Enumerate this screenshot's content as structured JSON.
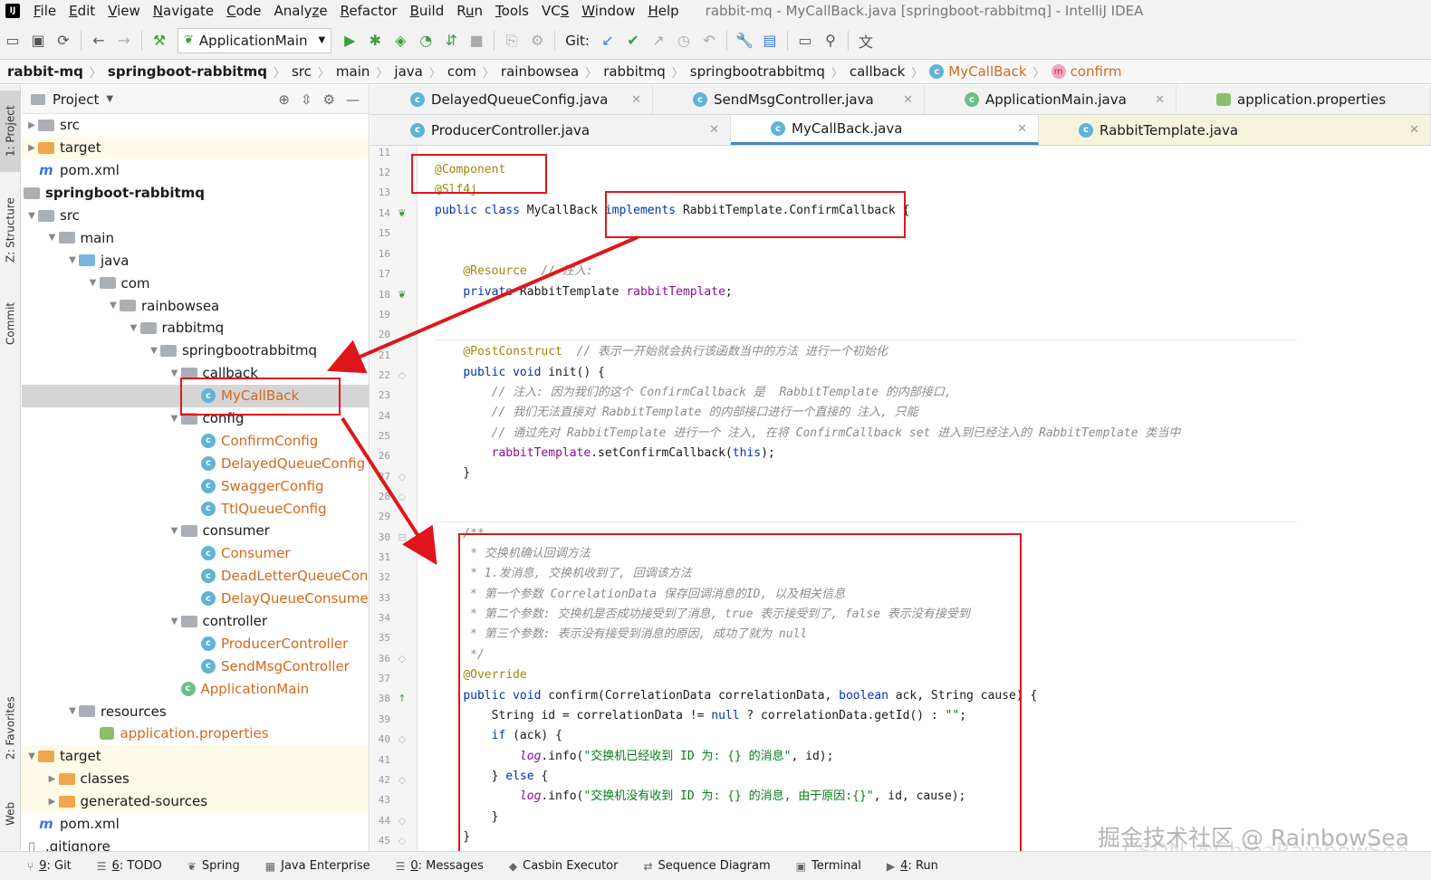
{
  "menu": {
    "items": [
      {
        "pre": "",
        "ul": "F",
        "post": "ile"
      },
      {
        "pre": "",
        "ul": "E",
        "post": "dit"
      },
      {
        "pre": "",
        "ul": "V",
        "post": "iew"
      },
      {
        "pre": "",
        "ul": "N",
        "post": "avigate"
      },
      {
        "pre": "",
        "ul": "C",
        "post": "ode"
      },
      {
        "pre": "Analy",
        "ul": "z",
        "post": "e"
      },
      {
        "pre": "",
        "ul": "R",
        "post": "efactor"
      },
      {
        "pre": "",
        "ul": "B",
        "post": "uild"
      },
      {
        "pre": "R",
        "ul": "u",
        "post": "n"
      },
      {
        "pre": "",
        "ul": "T",
        "post": "ools"
      },
      {
        "pre": "VC",
        "ul": "S",
        "post": ""
      },
      {
        "pre": "",
        "ul": "W",
        "post": "indow"
      },
      {
        "pre": "",
        "ul": "H",
        "post": "elp"
      }
    ],
    "window_title": "rabbit-mq - MyCallBack.java [springboot-rabbitmq] - IntelliJ IDEA"
  },
  "toolbar": {
    "run_config": "ApplicationMain",
    "git_label": "Git:"
  },
  "breadcrumb": [
    "rabbit-mq",
    "springboot-rabbitmq",
    "src",
    "main",
    "java",
    "com",
    "rainbowsea",
    "rabbitmq",
    "springbootrabbitmq",
    "callback",
    "MyCallBack",
    "confirm"
  ],
  "stripe": {
    "project": "1: Project",
    "structure": "Z: Structure",
    "commit": "Commit",
    "favorites": "2: Favorites",
    "web": "Web"
  },
  "project_panel": {
    "title": "Project",
    "tree": [
      {
        "label": "src",
        "indent": 0,
        "arrow": "▶",
        "icon": "folder",
        "style": ""
      },
      {
        "label": "target",
        "indent": 0,
        "arrow": "▶",
        "icon": "folder-orange",
        "style": "hl"
      },
      {
        "label": "pom.xml",
        "indent": 0,
        "arrow": "",
        "icon": "maven",
        "style": ""
      },
      {
        "label": "springboot-rabbitmq",
        "indent": -1,
        "arrow": "",
        "icon": "folder",
        "style": "bold"
      },
      {
        "label": "src",
        "indent": 0,
        "arrow": "▼",
        "icon": "folder",
        "style": ""
      },
      {
        "label": "main",
        "indent": 1,
        "arrow": "▼",
        "icon": "folder",
        "style": ""
      },
      {
        "label": "java",
        "indent": 2,
        "arrow": "▼",
        "icon": "folder-blue",
        "style": ""
      },
      {
        "label": "com",
        "indent": 3,
        "arrow": "▼",
        "icon": "folder",
        "style": ""
      },
      {
        "label": "rainbowsea",
        "indent": 4,
        "arrow": "▼",
        "icon": "folder",
        "style": ""
      },
      {
        "label": "rabbitmq",
        "indent": 5,
        "arrow": "▼",
        "icon": "folder",
        "style": ""
      },
      {
        "label": "springbootrabbitmq",
        "indent": 6,
        "arrow": "▼",
        "icon": "folder",
        "style": ""
      },
      {
        "label": "callback",
        "indent": 7,
        "arrow": "▼",
        "icon": "folder",
        "style": ""
      },
      {
        "label": "MyCallBack",
        "indent": 8,
        "arrow": "",
        "icon": "class",
        "style": "selected orange"
      },
      {
        "label": "config",
        "indent": 7,
        "arrow": "▼",
        "icon": "folder",
        "style": ""
      },
      {
        "label": "ConfirmConfig",
        "indent": 8,
        "arrow": "",
        "icon": "class",
        "style": "orange"
      },
      {
        "label": "DelayedQueueConfig",
        "indent": 8,
        "arrow": "",
        "icon": "class",
        "style": "orange"
      },
      {
        "label": "SwaggerConfig",
        "indent": 8,
        "arrow": "",
        "icon": "class",
        "style": "orange"
      },
      {
        "label": "TtlQueueConfig",
        "indent": 8,
        "arrow": "",
        "icon": "class",
        "style": "orange"
      },
      {
        "label": "consumer",
        "indent": 7,
        "arrow": "▼",
        "icon": "folder",
        "style": ""
      },
      {
        "label": "Consumer",
        "indent": 8,
        "arrow": "",
        "icon": "class",
        "style": "orange"
      },
      {
        "label": "DeadLetterQueueCon",
        "indent": 8,
        "arrow": "",
        "icon": "class",
        "style": "orange"
      },
      {
        "label": "DelayQueueConsumer",
        "indent": 8,
        "arrow": "",
        "icon": "class",
        "style": "orange"
      },
      {
        "label": "controller",
        "indent": 7,
        "arrow": "▼",
        "icon": "folder",
        "style": ""
      },
      {
        "label": "ProducerController",
        "indent": 8,
        "arrow": "",
        "icon": "class",
        "style": "orange"
      },
      {
        "label": "SendMsgController",
        "indent": 8,
        "arrow": "",
        "icon": "class",
        "style": "orange"
      },
      {
        "label": "ApplicationMain",
        "indent": 7,
        "arrow": "",
        "icon": "spring",
        "style": "orange"
      },
      {
        "label": "resources",
        "indent": 2,
        "arrow": "▼",
        "icon": "folder",
        "style": ""
      },
      {
        "label": "application.properties",
        "indent": 3,
        "arrow": "",
        "icon": "props",
        "style": "orange"
      },
      {
        "label": "target",
        "indent": 0,
        "arrow": "▼",
        "icon": "folder-orange",
        "style": "hl"
      },
      {
        "label": "classes",
        "indent": 1,
        "arrow": "▶",
        "icon": "folder-orange",
        "style": "hl"
      },
      {
        "label": "generated-sources",
        "indent": 1,
        "arrow": "▶",
        "icon": "folder-orange",
        "style": "hl"
      },
      {
        "label": "pom.xml",
        "indent": 0,
        "arrow": "",
        "icon": "maven",
        "style": ""
      },
      {
        "label": ".gitignore",
        "indent": -1,
        "arrow": "",
        "icon": "file",
        "style": ""
      }
    ]
  },
  "tabs_row1": [
    {
      "label": "DelayedQueueConfig.java",
      "icon": "class"
    },
    {
      "label": "SendMsgController.java",
      "icon": "class"
    },
    {
      "label": "ApplicationMain.java",
      "icon": "spring"
    },
    {
      "label": "application.properties",
      "icon": "props"
    }
  ],
  "tabs_row2": [
    {
      "label": "ProducerController.java",
      "icon": "class",
      "state": ""
    },
    {
      "label": "MyCallBack.java",
      "icon": "class",
      "state": "active"
    },
    {
      "label": "RabbitTemplate.java",
      "icon": "class",
      "state": "yellow"
    }
  ],
  "editor": {
    "line_numbers": [
      "11",
      "12",
      "13",
      "14",
      "15",
      "16",
      "17",
      "18",
      "19",
      "20",
      "21",
      "22",
      "23",
      "24",
      "25",
      "26",
      "27",
      "28",
      "29",
      "30",
      "31",
      "32",
      "33",
      "34",
      "35",
      "36",
      "37",
      "38",
      "39",
      "40",
      "41",
      "42",
      "43",
      "44",
      "45"
    ]
  },
  "status_bar": [
    {
      "num": "9",
      "label": ": Git",
      "icon": "⑂"
    },
    {
      "num": "6",
      "label": ": TODO",
      "icon": "☰"
    },
    {
      "num": "",
      "label": "Spring",
      "icon": "❦"
    },
    {
      "num": "",
      "label": "Java Enterprise",
      "icon": "▦"
    },
    {
      "num": "0",
      "label": ": Messages",
      "icon": "☰"
    },
    {
      "num": "",
      "label": "Casbin Executor",
      "icon": "◆"
    },
    {
      "num": "",
      "label": "Sequence Diagram",
      "icon": "⇄"
    },
    {
      "num": "",
      "label": "Terminal",
      "icon": "▣"
    },
    {
      "num": "4",
      "label": ": Run",
      "icon": "▶"
    }
  ],
  "watermark": "掘金技术社区 @ RainbowSea",
  "watermark2": "CSDN @ChinaRainbowSea",
  "colors": {
    "annotation_box": "#e0161b",
    "keyword": "#0033b3",
    "annotation": "#9e880d",
    "comment": "#8c8c8c",
    "field": "#871094",
    "string": "#067d17"
  }
}
